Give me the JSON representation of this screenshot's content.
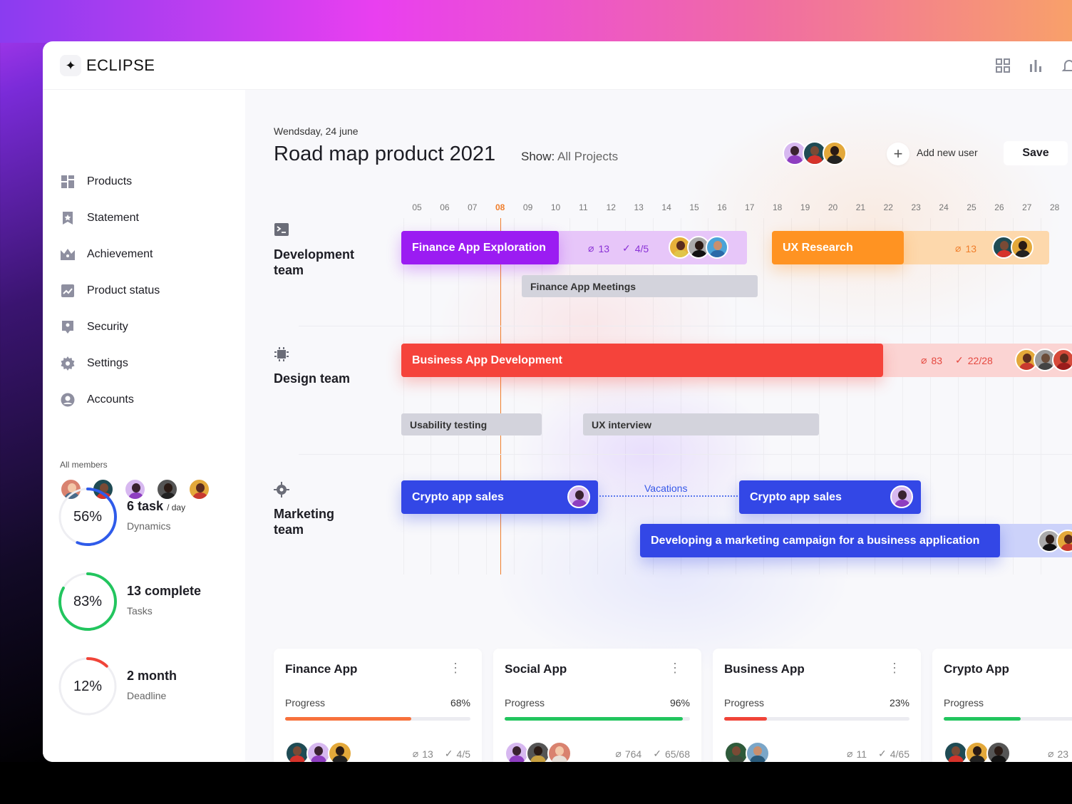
{
  "app": {
    "brand": "ECLIPSE"
  },
  "sidebar": {
    "items": [
      {
        "label": "Products",
        "icon": "grid-icon"
      },
      {
        "label": "Statement",
        "icon": "bookmark-star-icon"
      },
      {
        "label": "Achievement",
        "icon": "crown-icon"
      },
      {
        "label": "Product status",
        "icon": "trend-chart-icon"
      },
      {
        "label": "Security",
        "icon": "shield-icon"
      },
      {
        "label": "Settings",
        "icon": "gear-icon"
      },
      {
        "label": "Accounts",
        "icon": "user-circle-icon"
      }
    ],
    "members_label": "All members",
    "stats": [
      {
        "percent": "56%",
        "value": 0.56,
        "color": "#2f5bea",
        "title": "6 task",
        "title_suffix": "/ day",
        "subtitle": "Dynamics"
      },
      {
        "percent": "83%",
        "value": 0.83,
        "color": "#22c55e",
        "title": "13 complete",
        "title_suffix": "",
        "subtitle": "Tasks"
      },
      {
        "percent": "12%",
        "value": 0.12,
        "color": "#f04438",
        "title": "2 month",
        "title_suffix": "",
        "subtitle": "Deadline"
      }
    ]
  },
  "main": {
    "date": "Wendsday, 24 june",
    "title": "Road map product 2021",
    "show_label": "Show:",
    "show_value": "All Projects",
    "add_user": "Add new user",
    "save": "Save",
    "days": [
      "05",
      "06",
      "07",
      "08",
      "09",
      "10",
      "11",
      "12",
      "13",
      "14",
      "15",
      "16",
      "17",
      "18",
      "19",
      "20",
      "21",
      "22",
      "23",
      "24",
      "25",
      "26",
      "27",
      "28"
    ],
    "current_day": "08",
    "teams": [
      {
        "name": "Development team",
        "icon": "terminal-icon"
      },
      {
        "name": "Design team",
        "icon": "chip-icon"
      },
      {
        "name": "Marketing team",
        "icon": "target-icon"
      }
    ],
    "tasks": {
      "finance_exploration": {
        "label": "Finance App Exploration",
        "attachments": "13",
        "checks": "4/5",
        "color": "#9b1cf2"
      },
      "ux_research": {
        "label": "UX Research",
        "attachments": "13",
        "color": "#ff9322"
      },
      "finance_meetings": {
        "label": "Finance App Meetings"
      },
      "business_dev": {
        "label": "Business App Development",
        "attachments": "83",
        "checks": "22/28",
        "color": "#f5433b"
      },
      "usability": {
        "label": "Usability testing"
      },
      "ux_interview": {
        "label": "UX interview"
      },
      "crypto_sales_1": {
        "label": "Crypto app sales",
        "color": "#3347e6"
      },
      "vacations": {
        "label": "Vacations"
      },
      "crypto_sales_2": {
        "label": "Crypto app sales"
      },
      "marketing_campaign": {
        "label": "Developing a marketing campaign for a business application"
      }
    },
    "cards": [
      {
        "title": "Finance App",
        "progress_label": "Progress",
        "progress": "68%",
        "value": 0.68,
        "color": "#f7713c",
        "attachments": "13",
        "checks": "4/5"
      },
      {
        "title": "Social App",
        "progress_label": "Progress",
        "progress": "96%",
        "value": 0.96,
        "color": "#22c55e",
        "attachments": "764",
        "checks": "65/68"
      },
      {
        "title": "Business App",
        "progress_label": "Progress",
        "progress": "23%",
        "value": 0.23,
        "color": "#f04438",
        "attachments": "11",
        "checks": "4/65"
      },
      {
        "title": "Crypto App",
        "progress_label": "Progress",
        "progress": "",
        "value": 0.55,
        "color": "#22c55e",
        "attachments": "23",
        "checks": ""
      }
    ]
  }
}
